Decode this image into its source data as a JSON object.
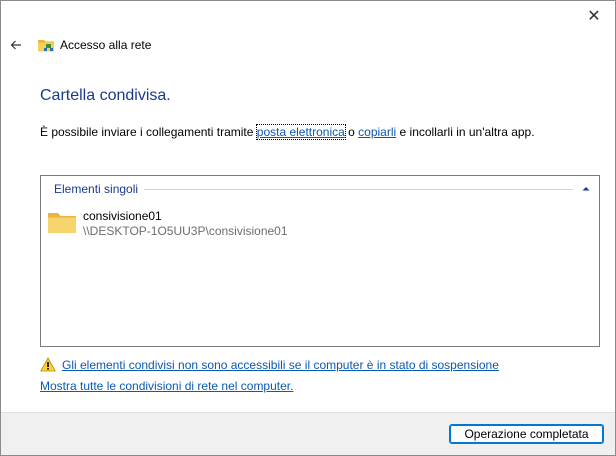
{
  "window": {
    "title": "Accesso alla rete",
    "close_glyph": "✕"
  },
  "icons": {
    "back": "back-arrow-icon",
    "header": "network-folder-icon",
    "folder": "folder-icon",
    "warning": "warning-icon",
    "collapse": "chevron-up-icon"
  },
  "main": {
    "heading": "Cartella condivisa.",
    "description_prefix": "È possibile inviare i collegamenti tramite ",
    "email_link": "posta elettronica",
    "description_middle": " o ",
    "copy_link": "copiarli",
    "description_suffix": " e incollarli in un'altra app."
  },
  "list": {
    "group_label": "Elementi singoli",
    "items": [
      {
        "name": "consivisione01",
        "path": "\\\\DESKTOP-1O5UU3P\\consivisione01"
      }
    ]
  },
  "links": {
    "warning": "Gli elementi condivisi non sono accessibili se il computer è in stato di sospensione",
    "show_all": "Mostra tutte le condivisioni di rete nel computer."
  },
  "footer": {
    "done_label": "Operazione completata"
  },
  "colors": {
    "heading": "#1a3a8c",
    "link": "#0a59b3",
    "accent": "#0078d4"
  }
}
